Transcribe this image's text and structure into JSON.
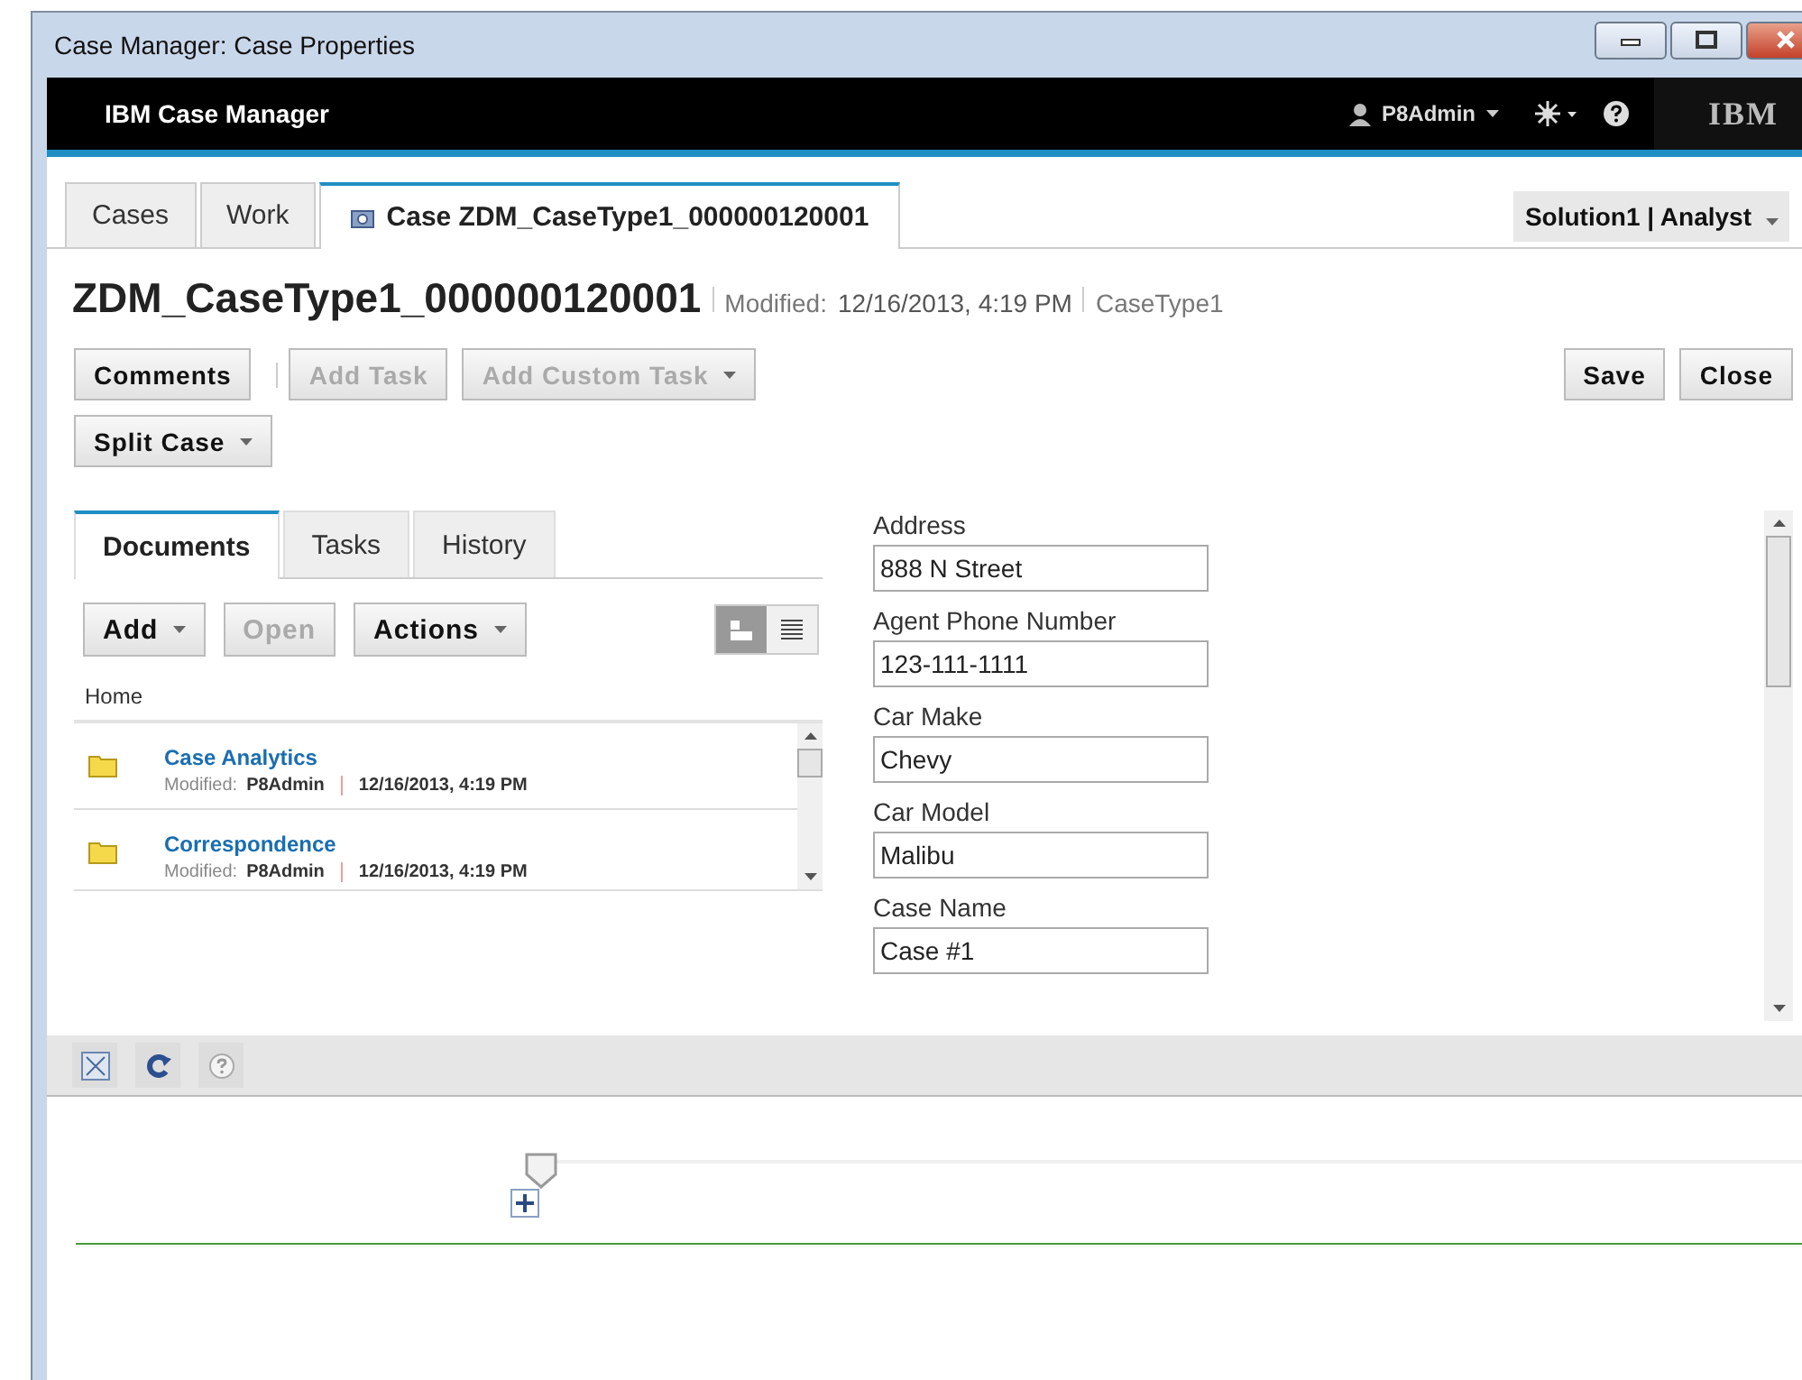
{
  "window": {
    "title": "Case Manager: Case Properties"
  },
  "header": {
    "app_title": "IBM Case Manager",
    "user": "P8Admin",
    "logo": "IBM"
  },
  "tabs": [
    {
      "label": "Cases",
      "selected": false,
      "kind": "plain"
    },
    {
      "label": "Work",
      "selected": false,
      "kind": "plain"
    },
    {
      "label": "Case ZDM_CaseType1_000000120001",
      "selected": true,
      "kind": "case"
    }
  ],
  "role_menu": "Solution1 | Analyst",
  "case": {
    "title": "ZDM_CaseType1_000000120001",
    "modified_label": "Modified:",
    "modified_value": "12/16/2013, 4:19 PM",
    "case_type": "CaseType1"
  },
  "actions": [
    {
      "label": "Comments",
      "disabled": false,
      "dropdown": false
    },
    {
      "label": "Add Task",
      "disabled": true,
      "dropdown": false
    },
    {
      "label": "Add Custom Task",
      "disabled": true,
      "dropdown": true
    },
    {
      "label": "Split Case",
      "disabled": false,
      "dropdown": true
    }
  ],
  "right_buttons": [
    "Save",
    "Close"
  ],
  "panel_tabs": [
    {
      "label": "Documents",
      "selected": true
    },
    {
      "label": "Tasks",
      "selected": false
    },
    {
      "label": "History",
      "selected": false
    }
  ],
  "doc_toolbar": [
    {
      "label": "Add",
      "disabled": false,
      "dropdown": true
    },
    {
      "label": "Open",
      "disabled": true,
      "dropdown": false
    },
    {
      "label": "Actions",
      "disabled": false,
      "dropdown": true
    }
  ],
  "view_toggles": [
    {
      "kind": "tree",
      "selected": true
    },
    {
      "kind": "list",
      "selected": false
    }
  ],
  "breadcrumb": "Home",
  "documents": [
    {
      "name": "Case Analytics",
      "modified_label": "Modified:",
      "user": "P8Admin",
      "date": "12/16/2013, 4:19 PM"
    },
    {
      "name": "Correspondence",
      "modified_label": "Modified:",
      "user": "P8Admin",
      "date": "12/16/2013, 4:19 PM"
    }
  ],
  "properties": [
    {
      "label": "Address",
      "value": "888 N Street"
    },
    {
      "label": "Agent Phone Number",
      "value": "123-111-1111"
    },
    {
      "label": "Car Make",
      "value": "Chevy"
    },
    {
      "label": "Car Model",
      "value": "Malibu"
    },
    {
      "label": "Case Name",
      "value": "Case #1"
    }
  ]
}
